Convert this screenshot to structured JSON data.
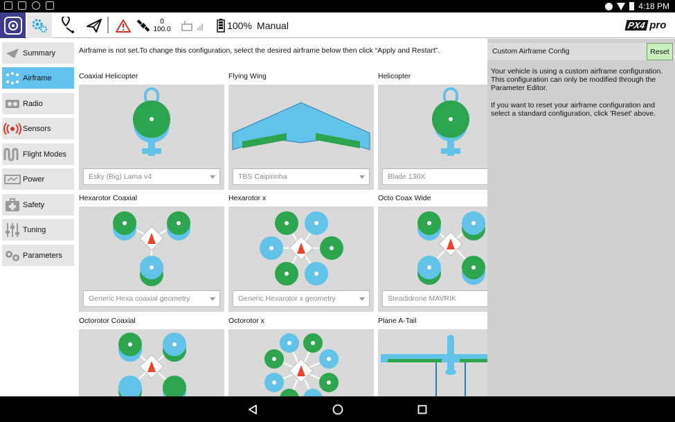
{
  "status_bar": {
    "time": "4:18 PM"
  },
  "toolbar": {
    "gps_count": "0",
    "gps_hdop": "100.0",
    "battery": "100%",
    "flight_mode": "Manual",
    "brand": "PX4 pro"
  },
  "sidebar": {
    "items": [
      {
        "label": "Summary",
        "icon": "paper-plane-icon"
      },
      {
        "label": "Airframe",
        "icon": "airframe-icon"
      },
      {
        "label": "Radio",
        "icon": "radio-icon"
      },
      {
        "label": "Sensors",
        "icon": "sensors-icon"
      },
      {
        "label": "Flight Modes",
        "icon": "flight-modes-icon"
      },
      {
        "label": "Power",
        "icon": "power-icon"
      },
      {
        "label": "Safety",
        "icon": "safety-icon"
      },
      {
        "label": "Tuning",
        "icon": "tuning-icon"
      },
      {
        "label": "Parameters",
        "icon": "parameters-icon"
      }
    ]
  },
  "main": {
    "notice": "Airframe is not set.To change this configuration, select the desired airframe below then click “Apply and Restart”.",
    "airframes": [
      {
        "title": "Coaxial Helicopter",
        "select": "Esky (Big) Lama v4"
      },
      {
        "title": "Flying Wing",
        "select": "TBS Caipirinha"
      },
      {
        "title": "Helicopter",
        "select": "Blade 130X"
      },
      {
        "title": "Hexarotor Coaxial",
        "select": "Generic Hexa coaxial geometry"
      },
      {
        "title": "Hexarotor x",
        "select": "Generic Hexarotor x geometry"
      },
      {
        "title": "Octo Coax Wide",
        "select": "Steadidrone MAVRIK"
      },
      {
        "title": "Octorotor Coaxial",
        "select": ""
      },
      {
        "title": "Octorotor x",
        "select": ""
      },
      {
        "title": "Plane A-Tail",
        "select": ""
      }
    ]
  },
  "panel": {
    "title": "Custom Airframe Config",
    "reset_label": "Reset",
    "text1": "Your vehicle is using a custom airframe configuration. This configuration can only be modified through the Parameter Editor.",
    "text2": "If you want to reset your airframe configuration and select a standard configuration, click 'Reset' above."
  },
  "colors": {
    "accent": "#63c2f0",
    "rotor_green": "#2da44e",
    "rotor_blue": "#63c2e8",
    "header_purple": "#3d3b8c"
  }
}
